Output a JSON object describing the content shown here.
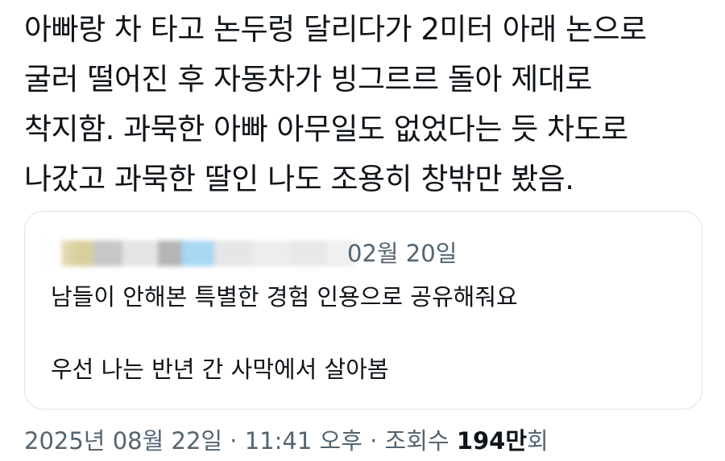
{
  "tweet": {
    "lines": [
      "아빠랑 차 타고 논두렁 달리다가 2미터 아래 논으로",
      "굴러 떨어진 후 자동차가 빙그르르 돌아 제대로",
      "착지함. 과묵한 아빠 아무일도 없었다는 듯 차도로",
      "나갔고 과묵한 딸인 나도 조용히 창밖만 봤음."
    ]
  },
  "quote": {
    "date": "02월 20일",
    "line1": "남들이 안해본 특별한 경험 인용으로 공유해줘요",
    "line2": "우선 나는 반년 간 사막에서 살아봄",
    "blur_colors": [
      "#d8cf9c",
      "#c7c7c7",
      "#e4e4e4",
      "#b5b5b5",
      "#a8d8f3",
      "#e6e6e6",
      "#ededed",
      "#e8e8e8",
      "#f0f0f0"
    ]
  },
  "meta": {
    "timestamp": "2025년 08월 22일 · 11:41 오후 · 조회수 ",
    "views_number": "194만",
    "views_suffix": "회"
  }
}
